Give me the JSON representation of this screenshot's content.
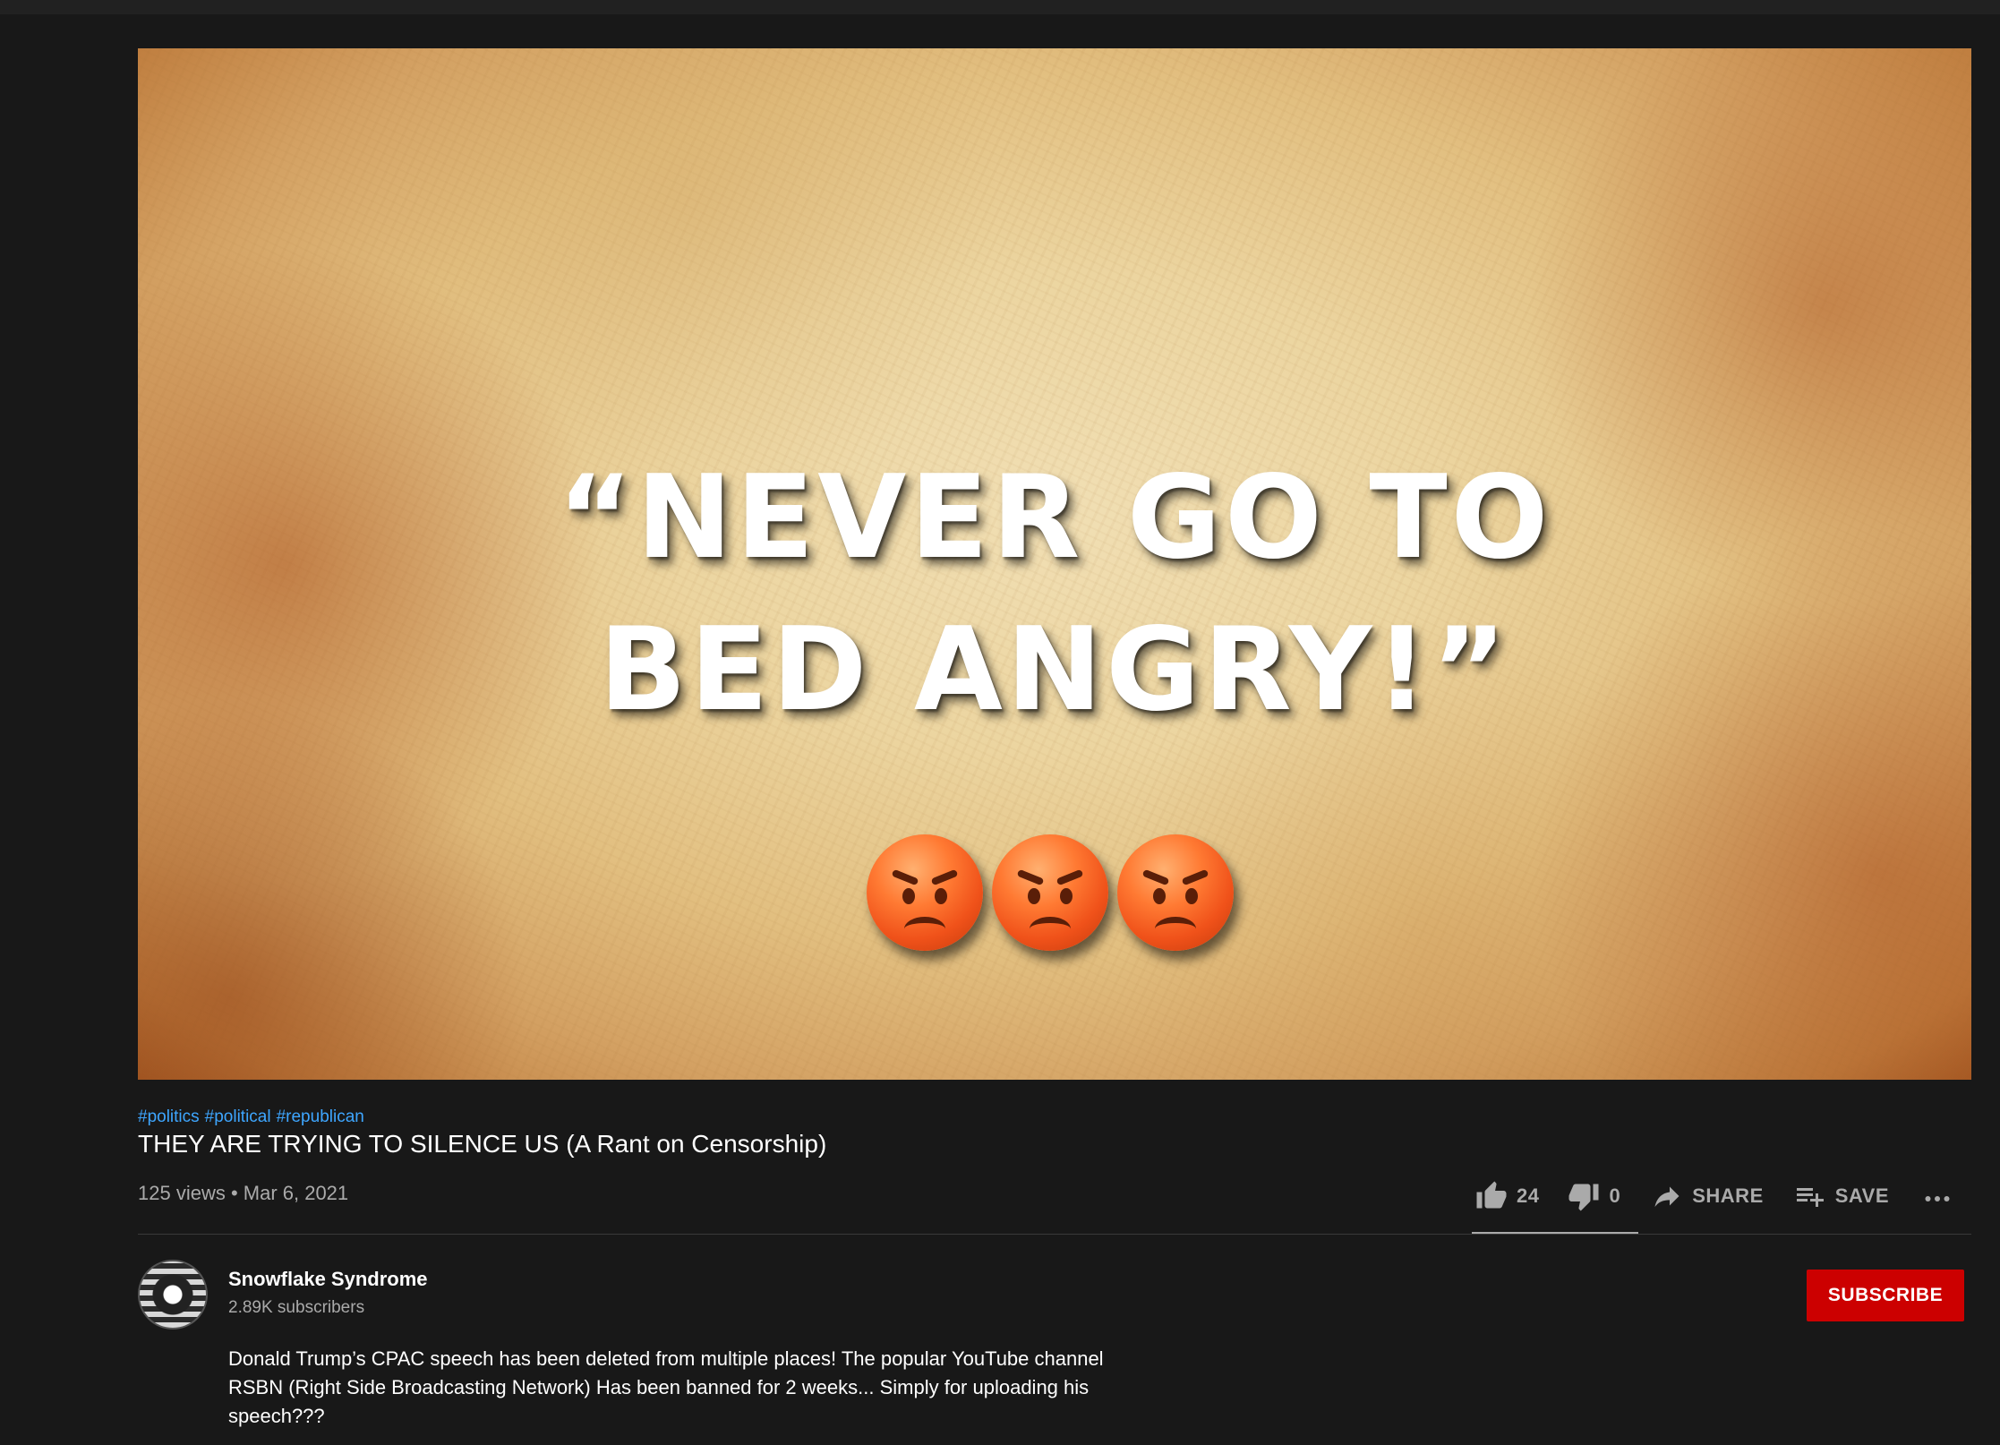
{
  "video": {
    "thumbnail_text_line1": "“NEVER GO TO",
    "thumbnail_text_line2": "BED ANGRY!”",
    "emoji_icon": "angry-face-icon",
    "emoji_count": 3
  },
  "hashtags": [
    "#politics",
    "#political",
    "#republican"
  ],
  "title": "THEY ARE TRYING TO SILENCE US (A Rant on Censorship)",
  "meta": "125 views • Mar 6, 2021",
  "actions": {
    "likes": "24",
    "dislikes": "0",
    "share_label": "SHARE",
    "save_label": "SAVE"
  },
  "channel": {
    "name": "Snowflake Syndrome",
    "subscribers": "2.89K subscribers",
    "subscribe_label": "SUBSCRIBE"
  },
  "description": "Donald Trump’s CPAC speech has been deleted from multiple places! The popular YouTube channel RSBN (Right Side Broadcasting Network) Has been banned for 2 weeks... Simply for uploading his speech???",
  "colors": {
    "background": "#181818",
    "hashtag": "#3ea6ff",
    "subscribe": "#cc0000",
    "secondary_text": "#aaaaaa"
  }
}
